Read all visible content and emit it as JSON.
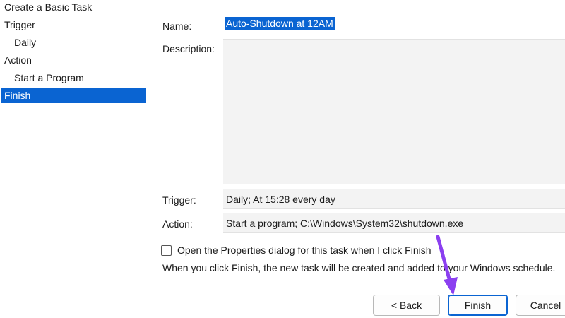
{
  "sidebar": {
    "items": [
      {
        "label": "Create a Basic Task"
      },
      {
        "label": "Trigger"
      },
      {
        "label": "Daily"
      },
      {
        "label": "Action"
      },
      {
        "label": "Start a Program"
      },
      {
        "label": "Finish"
      }
    ]
  },
  "form": {
    "name_label": "Name:",
    "name_value": "Auto-Shutdown at 12AM",
    "description_label": "Description:",
    "description_value": "",
    "trigger_label": "Trigger:",
    "trigger_value": "Daily; At 15:28 every day",
    "action_label": "Action:",
    "action_value": "Start a program; C:\\Windows\\System32\\shutdown.exe"
  },
  "options": {
    "open_properties_label": "Open the Properties dialog for this task when I click Finish",
    "open_properties_checked": false,
    "info_text": "When you click Finish, the new task will be created and added to your Windows schedule."
  },
  "buttons": {
    "back_label": "< Back",
    "finish_label": "Finish",
    "cancel_label": "Cancel"
  },
  "colors": {
    "selection": "#0a64d2",
    "annotation_arrow": "#8b3ff0"
  },
  "annotation": {
    "icon": "arrow-pointer-icon"
  }
}
